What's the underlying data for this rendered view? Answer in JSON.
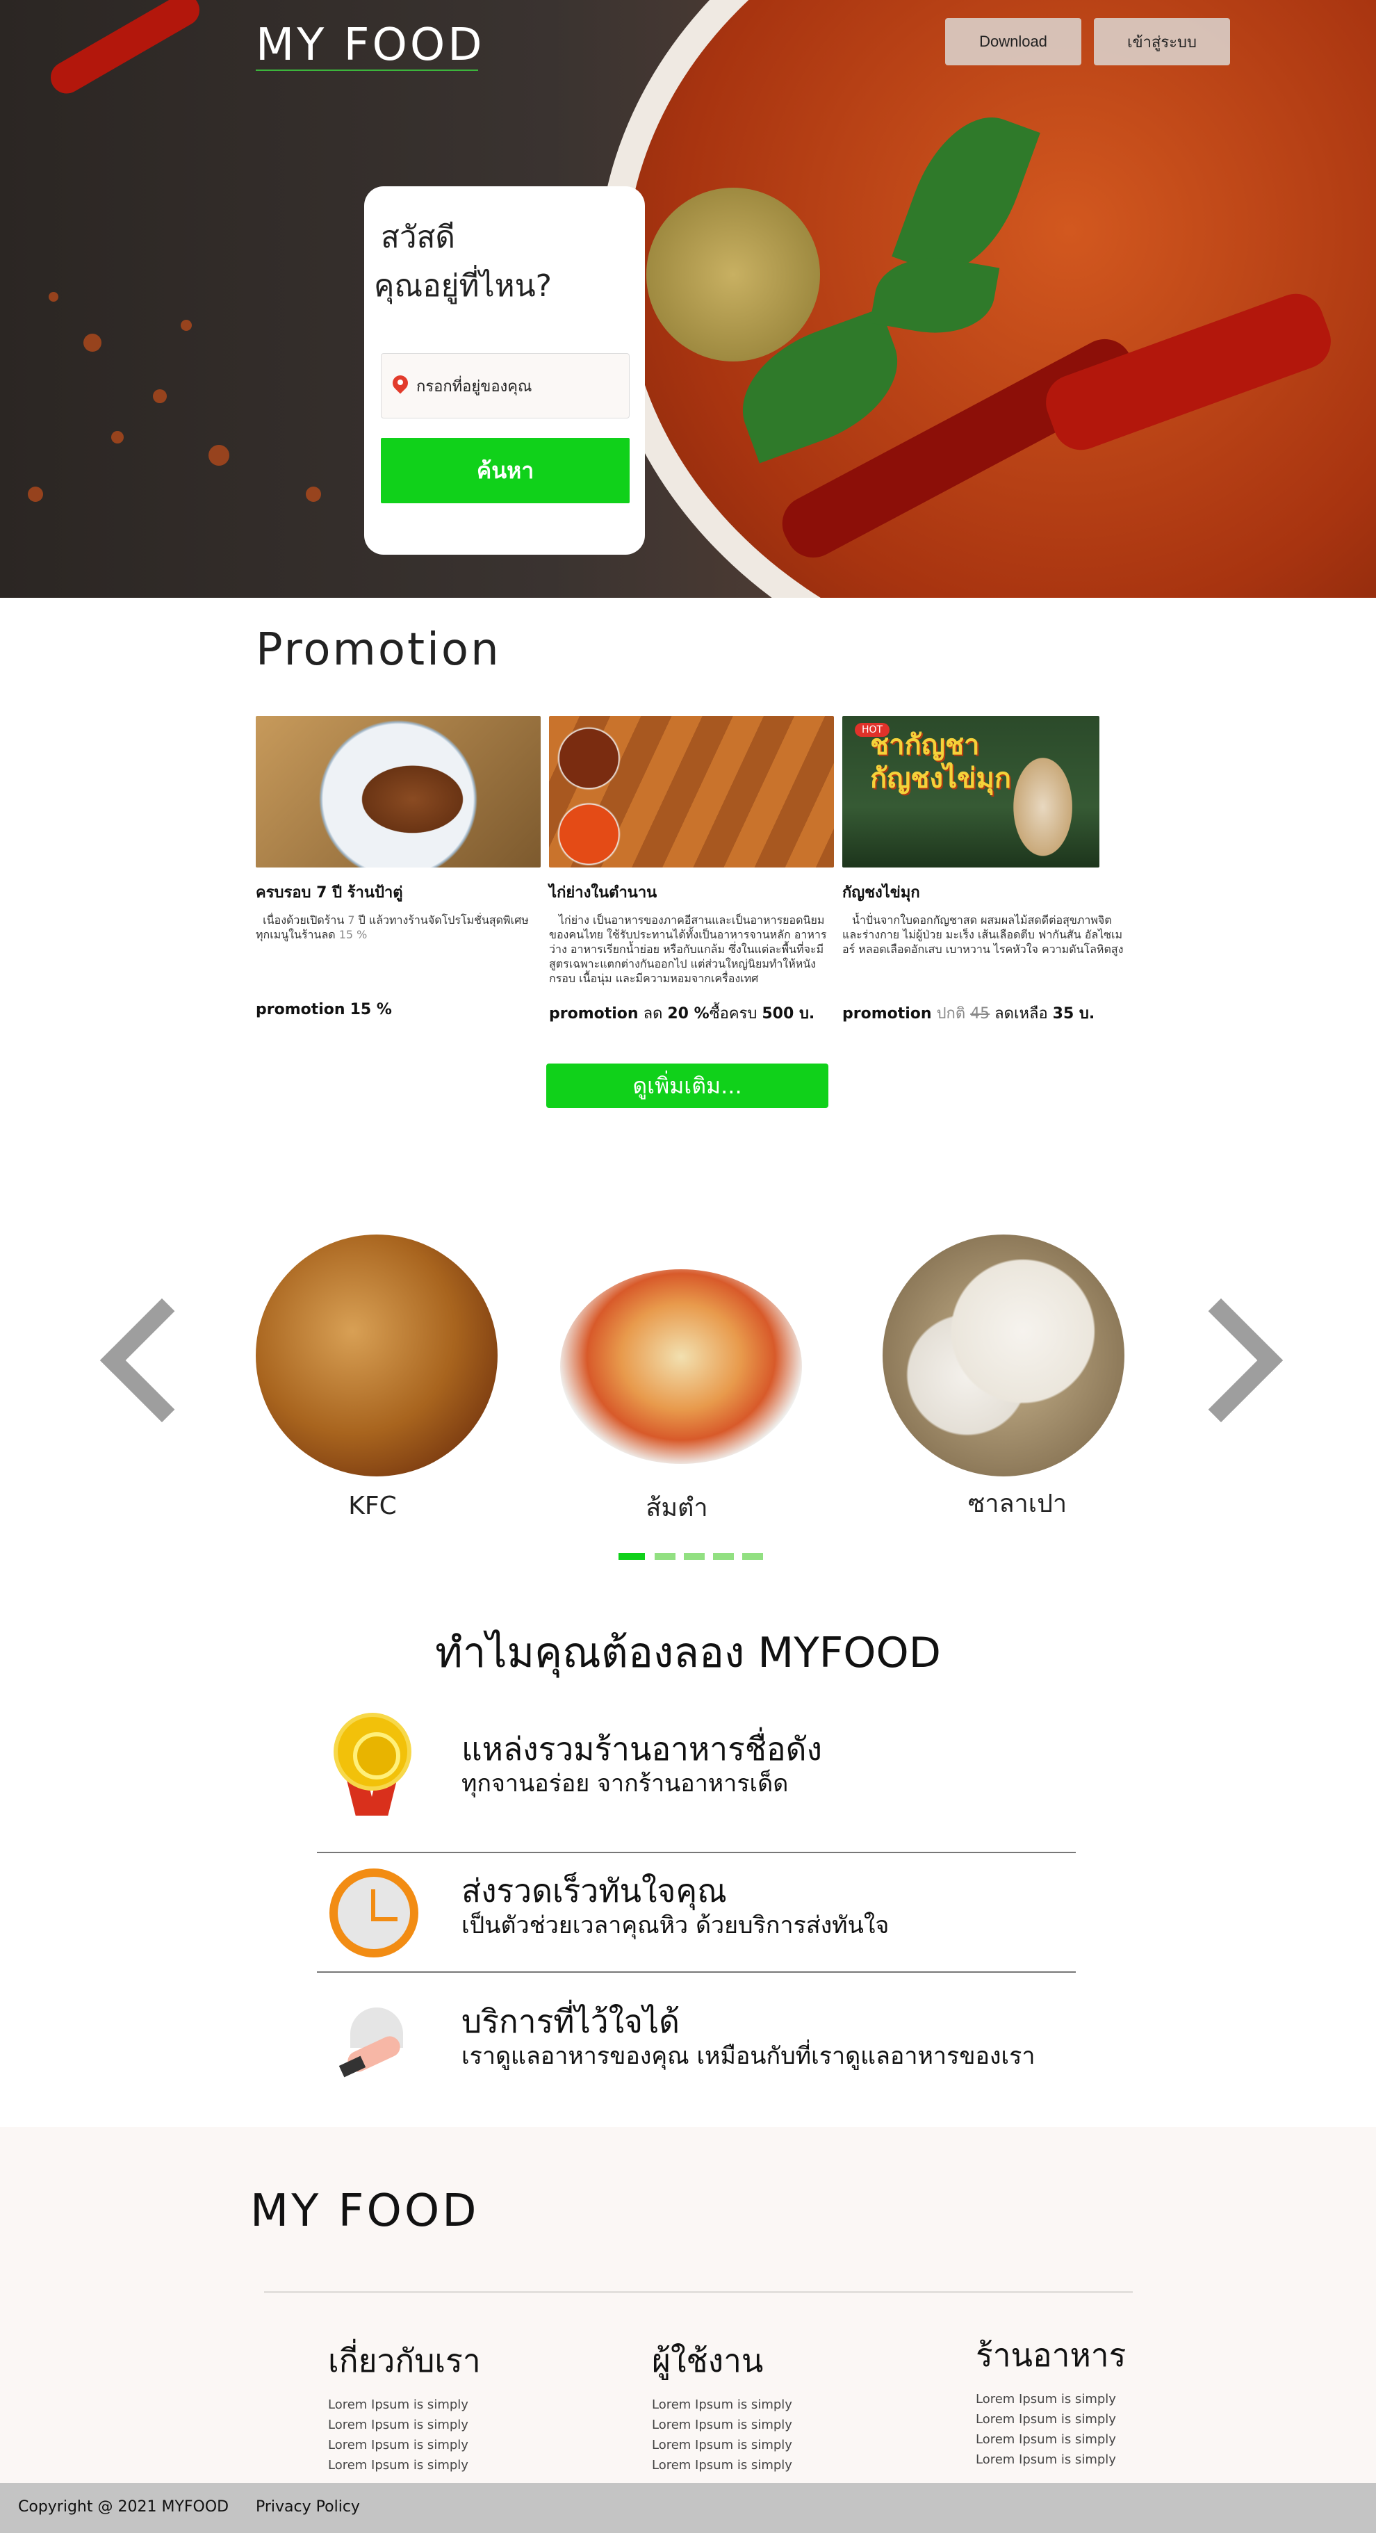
{
  "brand": {
    "logo": "MY FOOD"
  },
  "header": {
    "download_label": "Download",
    "login_label": "เข้าสู่ระบบ"
  },
  "search": {
    "greeting_line1": "สวัสดี",
    "greeting_line2": "คุณอยู่ที่ไหน?",
    "placeholder": "กรอกที่อยู่ของคุณ",
    "button_label": "ค้นหา"
  },
  "promotion": {
    "title": "Promotion",
    "items": [
      {
        "title": "ครบรอบ 7 ปี ร้านป้าตู่",
        "desc_a": "เนื่องด้วยเปิดร้าน ",
        "desc_num1": "7",
        "desc_b": " ปี แล้วทางร้านจัดโปรโมชั่นสุดพิเศษทุกเมนูในร้านลด ",
        "desc_num2": "15 %",
        "promo_label": "promotion",
        "promo_value": "15 %"
      },
      {
        "title": "ไก่ย่างในตำนาน",
        "desc": "ไก่ย่าง เป็นอาหารของภาคอีสานและเป็นอาหารยอดนิยมของคนไทย ใช้รับประทานได้ทั้งเป็นอาหารจานหลัก อาหารว่าง อาหารเรียกน้ำย่อย หรือกับแกล้ม ซึ่งในแต่ละพื้นที่จะมีสูตรเฉพาะแตกต่างกันออกไป แต่ส่วนใหญ่นิยมทำให้หนังกรอบ เนื้อนุ่ม และมีความหอมจากเครื่องเทศ",
        "promo_label": "promotion",
        "promo_pre": "ลด",
        "promo_value": "20 %",
        "promo_mid": "ซื้อครบ",
        "promo_amount": "500 บ."
      },
      {
        "title": "กัญชงไข่มุก",
        "desc": "น้ำปั่นจากใบดอกกัญชาสด ผสมผลไม้สดดีต่อสุขภาพจิตและร่างกาย ไม่ผู้ป่วย มะเร็ง เส้นเลือดตีบ ฟากันสัน อัลไซเมอร์ หลอดเลือดอักเสบ เบาหวาน ไรคหัวใจ ความดันโลหิตสูง",
        "promo_label": "promotion",
        "promo_normal_label": "ปกติ",
        "promo_normal_price": "45",
        "promo_now_label": "ลดเหลือ",
        "promo_now_price": "35 บ.",
        "badge_hot": "HOT",
        "image_text_1": "ชากัญชา",
        "image_text_2": "กัญชงไข่มุก"
      }
    ],
    "more_label": "ดูเพิ่มเติม..."
  },
  "carousel": {
    "items": [
      {
        "label": "KFC"
      },
      {
        "label": "ส้มตำ"
      },
      {
        "label": "ซาลาเปา"
      }
    ],
    "dot_count": 5,
    "active_index": 0,
    "active_color": "#10d11a",
    "inactive_color": "#92e082"
  },
  "why": {
    "title": "ทำไมคุณต้องลอง MYFOOD",
    "rows": [
      {
        "title": "แหล่งรวมร้านอาหารชื่อดัง",
        "subtitle": "ทุกจานอร่อย จากร้านอาหารเด็ด",
        "icon": "medal-icon"
      },
      {
        "title": "ส่งรวดเร็วทันใจคุณ",
        "subtitle": "เป็นตัวช่วยเวลาคุณหิว ด้วยบริการส่งทันใจ",
        "icon": "clock-icon"
      },
      {
        "title": "บริการที่ไว้ใจได้",
        "subtitle": "เราดูแลอาหารของคุณ เหมือนกับที่เราดูแลอาหารของเรา",
        "icon": "service-bell-icon"
      }
    ]
  },
  "footer": {
    "logo": "MY FOOD",
    "columns": [
      {
        "heading": "เกี่ยวกับเรา",
        "links": [
          "Lorem Ipsum is simply",
          "Lorem Ipsum is simply",
          "Lorem Ipsum is simply",
          "Lorem Ipsum is simply"
        ]
      },
      {
        "heading": "ผู้ใช้งาน",
        "links": [
          "Lorem Ipsum is simply",
          "Lorem Ipsum is simply",
          "Lorem Ipsum is simply",
          "Lorem Ipsum is simply"
        ]
      },
      {
        "heading": "ร้านอาหาร",
        "links": [
          "Lorem Ipsum is simply",
          "Lorem Ipsum is simply",
          "Lorem Ipsum is simply",
          "Lorem Ipsum is simply"
        ]
      }
    ],
    "copyright": "Copyright @ 2021 MYFOOD",
    "privacy": "Privacy Policy"
  },
  "colors": {
    "accent_green": "#10d11a",
    "pin_red": "#e23b2c",
    "clock_orange": "#f28c13",
    "medal_gold": "#f2c10a"
  }
}
